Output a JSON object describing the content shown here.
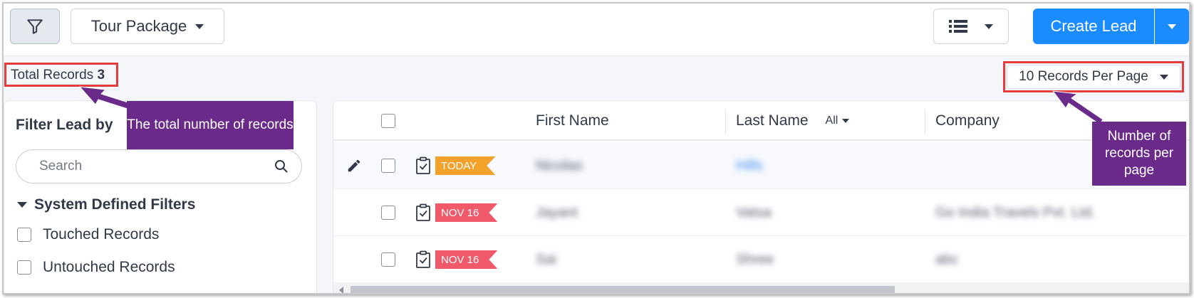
{
  "toolbar": {
    "filter_icon": "funnel-icon",
    "view_label": "Tour Package",
    "list_icon": "list-view-icon",
    "create_label": "Create Lead"
  },
  "summary": {
    "total_label": "Total Records",
    "total_count": "3",
    "per_page": "10 Records Per Page"
  },
  "filter_panel": {
    "title": "Filter Lead by",
    "search_placeholder": "Search",
    "section_title": "System Defined Filters",
    "options": [
      "Touched Records",
      "Untouched Records"
    ]
  },
  "table": {
    "columns": [
      "First Name",
      "Last Name",
      "Company"
    ],
    "last_name_filter": "All",
    "rows": [
      {
        "tag": "TODAY",
        "first": "Nicolas",
        "last": "Hills",
        "company": ""
      },
      {
        "tag": "NOV 16",
        "first": "Jayant",
        "last": "Vatsa",
        "company": "Go India Travels Pvt. Ltd."
      },
      {
        "tag": "NOV 16",
        "first": "Sai",
        "last": "Shree",
        "company": "abc"
      }
    ]
  },
  "annotations": {
    "total_callout": "The total number of records",
    "per_page_callout": "Number of records per page"
  },
  "colors": {
    "primary": "#1a8cff",
    "today_tag": "#f2a12b",
    "date_tag": "#f0596a",
    "callout": "#6a2a8a",
    "highlight_box": "#e53b3b"
  }
}
